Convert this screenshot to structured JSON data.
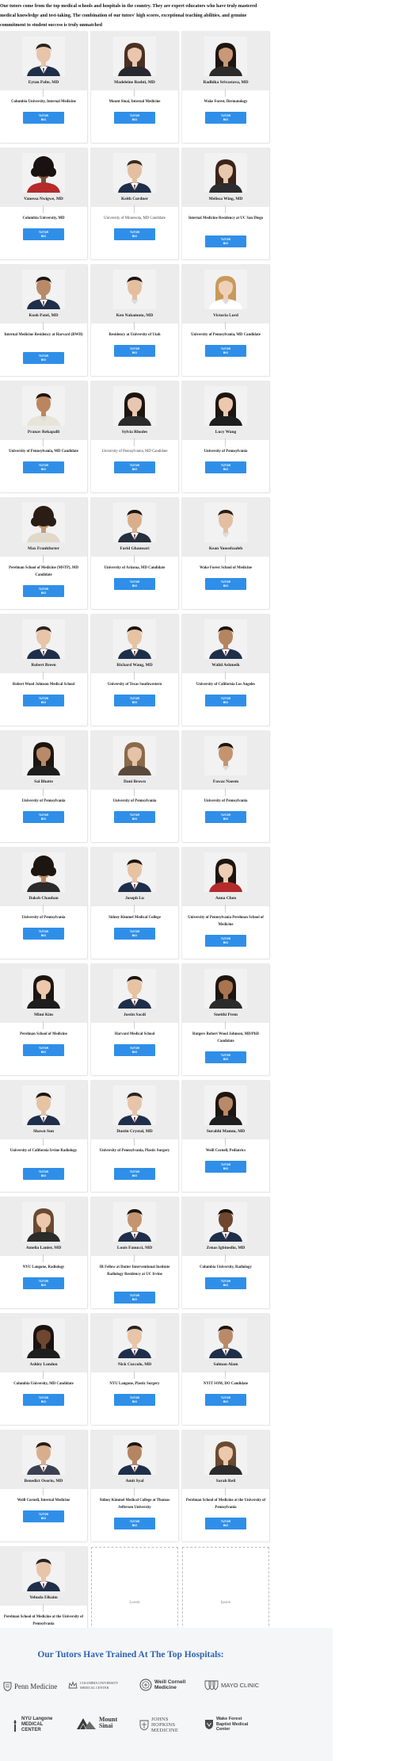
{
  "intro": "Our tutors come from the top medical schools and hospitals in the country. They are expert educators who have truly mastered medical knowledge and test-taking. The combination of our tutors' high scores, exceptional teaching abilities, and genuine commitment to student success is truly unmatched",
  "button": {
    "line1": "TUTOR",
    "line2": "BIO"
  },
  "colors": {
    "button": "#2f8fe8",
    "band": "#ececec",
    "heading": "#2a63b2"
  },
  "tutors": [
    {
      "name": "Eytan Palte, MD",
      "school": "Columbia University, Internal Medicine",
      "skin": "#e8c4a8",
      "hair": "#2a2420",
      "shirt": "#1f2f4a",
      "hairstyle": "short",
      "shirtstyle": "suit"
    },
    {
      "name": "Madeleine Bashti, MD",
      "school": "Mount Sinai, Internal Medicine",
      "skin": "#e9c6ac",
      "hair": "#4a3022",
      "shirt": "#27292e",
      "hairstyle": "long",
      "shirtstyle": "dark"
    },
    {
      "name": "Radhika Srivastava, MD",
      "school": "Wake Forest, Dermatology",
      "skin": "#c89878",
      "hair": "#1d1510",
      "shirt": "#2b2b2b",
      "hairstyle": "long",
      "shirtstyle": "dark"
    },
    {
      "name": "Vanessa Nwigwe, MD",
      "school": "Columbia University, MD",
      "skin": "#7a4f36",
      "hair": "#1a1210",
      "shirt": "#b52a2a",
      "hairstyle": "curly",
      "shirtstyle": "red"
    },
    {
      "name": "Keith Cordner",
      "school": "University of Minnesota, MD Candidate",
      "light": true,
      "skin": "#e3bfa2",
      "hair": "#3a2a20",
      "shirt": "#1f2f4a",
      "hairstyle": "short",
      "shirtstyle": "suit"
    },
    {
      "name": "Melissa Wing, MD",
      "school": "Internal Medicine Residency at UC San Diego",
      "skin": "#e9c7ad",
      "hair": "#3a2418",
      "shirt": "#2d2d30",
      "hairstyle": "long",
      "shirtstyle": "dark"
    },
    {
      "name": "Kush Patel, MD",
      "school": "Internal Medicine Residency at Harvard (BWH)",
      "skin": "#b98a68",
      "hair": "#1d1510",
      "shirt": "#1f2f4a",
      "hairstyle": "short",
      "shirtstyle": "suit"
    },
    {
      "name": "Ken Nakamoto, MD",
      "school": "Residency at University of Utah",
      "skin": "#e3bf9f",
      "hair": "#1d1510",
      "shirt": "#f2f2f2",
      "hairstyle": "short",
      "shirtstyle": "white"
    },
    {
      "name": "Victoria Lord",
      "school": "University of Pennsylvania, MD Candidate",
      "skin": "#efd0b8",
      "hair": "#c89a5a",
      "shirt": "#ffffff",
      "hairstyle": "long",
      "shirtstyle": "white"
    },
    {
      "name": "Pranav Rekapalli",
      "school": "University of Pennsylvania, MD Candidate",
      "skin": "#b9865f",
      "hair": "#1d1510",
      "shirt": "#e9e4d8",
      "hairstyle": "short",
      "shirtstyle": "white"
    },
    {
      "name": "Sylvia Rhodes",
      "school": "University of Pennsylvania, MD Candidate",
      "light": true,
      "skin": "#e8c7b0",
      "hair": "#1d1510",
      "shirt": "#2b2b2b",
      "hairstyle": "long",
      "shirtstyle": "dark"
    },
    {
      "name": "Lucy Wang",
      "school": "University of Pennsylvania",
      "skin": "#ecc9ad",
      "hair": "#1d1510",
      "shirt": "#1e1e1e",
      "hairstyle": "long",
      "shirtstyle": "dark"
    },
    {
      "name": "Max Frankfurter",
      "school": "Perelman School of Medicine (MSTP), MD Candidate",
      "skin": "#c89a74",
      "hair": "#2a1d14",
      "shirt": "#e0d9c8",
      "hairstyle": "curly",
      "shirtstyle": "white"
    },
    {
      "name": "Farid Ghamsari",
      "school": "University of Arizona, MD Candidate",
      "skin": "#d9ae8c",
      "hair": "#1d1510",
      "shirt": "#26303e",
      "hairstyle": "short",
      "shirtstyle": "suit"
    },
    {
      "name": "Kean Yousefzadeh",
      "school": "Wake Forest School of Medicine",
      "skin": "#e3bfa2",
      "hair": "#2a1d14",
      "shirt": "#f2f2f2",
      "hairstyle": "short",
      "shirtstyle": "white"
    },
    {
      "name": "Robert Breen",
      "school": "Robert Wood Johnson Medical School",
      "skin": "#e8c4a8",
      "hair": "#2a2420",
      "shirt": "#1f2f4a",
      "hairstyle": "short",
      "shirtstyle": "suit"
    },
    {
      "name": "Richard Wang, MD",
      "school": "University of Texas Southwestern",
      "skin": "#e6c3a3",
      "hair": "#1d1510",
      "shirt": "#1f2f4a",
      "hairstyle": "short",
      "shirtstyle": "suit"
    },
    {
      "name": "Walid Ashmeik",
      "school": "University of California Los Angeles",
      "skin": "#b58562",
      "hair": "#1d1510",
      "shirt": "#1f2f4a",
      "hairstyle": "short",
      "shirtstyle": "suit"
    },
    {
      "name": "Sai Bhatte",
      "school": "University of Pennsylvania",
      "skin": "#b98a68",
      "hair": "#1d1510",
      "shirt": "#1e1e1e",
      "hairstyle": "long",
      "shirtstyle": "dark"
    },
    {
      "name": "Dani Brown",
      "school": "University of Pennsylvania",
      "skin": "#e6c2a6",
      "hair": "#8a6a4a",
      "shirt": "#5a4a3c",
      "hairstyle": "long",
      "shirtstyle": "dark"
    },
    {
      "name": "Fawaz Naeem",
      "school": "University of Pennsylvania",
      "skin": "#c49470",
      "hair": "#1d1510",
      "shirt": "#f2f2f2",
      "hairstyle": "short",
      "shirtstyle": "white"
    },
    {
      "name": "Daksh Chauhan",
      "school": "University of Pennsylvania",
      "skin": "#b9865f",
      "hair": "#1d1510",
      "shirt": "#2b2b2b",
      "hairstyle": "curly",
      "shirtstyle": "dark"
    },
    {
      "name": "Joseph Lu",
      "school": "Sidney Kimmel Medical College",
      "skin": "#e6c3a3",
      "hair": "#1d1510",
      "shirt": "#1f2f4a",
      "hairstyle": "short",
      "shirtstyle": "suit"
    },
    {
      "name": "Anna Chen",
      "school": "University of Pennsylvania Perelman School of Medicine",
      "skin": "#edcdb3",
      "hair": "#1d1510",
      "shirt": "#b52a2a",
      "hairstyle": "long",
      "shirtstyle": "red"
    },
    {
      "name": "Mimi Kim",
      "school": "Perelman School of Medicine",
      "skin": "#ecc9ad",
      "hair": "#1d1510",
      "shirt": "#1e1e1e",
      "hairstyle": "long",
      "shirtstyle": "dark"
    },
    {
      "name": "Justin Sacdi",
      "school": "Harvard Medical School",
      "skin": "#e6c3a3",
      "hair": "#1d1510",
      "shirt": "#1f2f4a",
      "hairstyle": "short",
      "shirtstyle": "suit"
    },
    {
      "name": "Sneithi Prem",
      "school": "Rutgers Robert Wood Johnson, MD/PhD Candidate",
      "skin": "#a9754f",
      "hair": "#1d1510",
      "shirt": "#2b2b2b",
      "hairstyle": "long",
      "shirtstyle": "dark"
    },
    {
      "name": "Shawn Sun",
      "school": "University of California Irvine Radiology",
      "skin": "#e6c3a3",
      "hair": "#1d1510",
      "shirt": "#1f2f4a",
      "hairstyle": "short",
      "shirtstyle": "suit"
    },
    {
      "name": "Dustin Crystal, MD",
      "school": "University of Pennsylvania, Plastic Surgery",
      "skin": "#e8c4a8",
      "hair": "#2a2420",
      "shirt": "#1f2f4a",
      "hairstyle": "short",
      "shirtstyle": "suit"
    },
    {
      "name": "Surabhi Mamm, MD",
      "school": "Weill Cornell, Pediatrics",
      "skin": "#b98a68",
      "hair": "#1d1510",
      "shirt": "#1e1e1e",
      "hairstyle": "long",
      "shirtstyle": "dark"
    },
    {
      "name": "Amelia Lanier, MD",
      "school": "NYU Langone, Radiology",
      "skin": "#ecc9ad",
      "hair": "#6a4a30",
      "shirt": "#2b2b2b",
      "hairstyle": "long",
      "shirtstyle": "dark"
    },
    {
      "name": "Louis Fanucci, MD",
      "school": "IR Fellow at Dotter Interventional Institute Radiology Residency at UC Irvine",
      "skin": "#c49470",
      "hair": "#1d1510",
      "shirt": "#1f2f4a",
      "hairstyle": "short",
      "shirtstyle": "suit"
    },
    {
      "name": "Zenas Igbinedio, MD",
      "school": "Columbia University, Radiology",
      "skin": "#6f4630",
      "hair": "#1a1210",
      "shirt": "#1f2f4a",
      "hairstyle": "short",
      "shirtstyle": "suit"
    },
    {
      "name": "Ashley London",
      "school": "Columbia University, MD Candidate",
      "skin": "#6f4630",
      "hair": "#1a1210",
      "shirt": "#1e1e1e",
      "hairstyle": "long",
      "shirtstyle": "dark"
    },
    {
      "name": "Nick Cuccolo, MD",
      "school": "NYU Langone, Plastic Surgery",
      "skin": "#e8c4a8",
      "hair": "#2a2420",
      "shirt": "#1f2f4a",
      "hairstyle": "short",
      "shirtstyle": "suit"
    },
    {
      "name": "Salman Alam",
      "school": "NYIT SOM, DO Candidate",
      "skin": "#b98a68",
      "hair": "#1d1510",
      "shirt": "#1f2f4a",
      "hairstyle": "short",
      "shirtstyle": "suit"
    },
    {
      "name": "Benedict Osorio, MD",
      "school": "Weill Cornell, Internal Medicine",
      "skin": "#d9ae8c",
      "hair": "#2a1d14",
      "shirt": "#3a4050",
      "hairstyle": "short",
      "shirtstyle": "suit"
    },
    {
      "name": "Amit Syal",
      "school": "Sidney Kimmel Medical College at Thomas Jefferson University",
      "skin": "#b58562",
      "hair": "#1d1510",
      "shirt": "#1f2f4a",
      "hairstyle": "short",
      "shirtstyle": "suit"
    },
    {
      "name": "Sarah Reil",
      "school": "Perelman School of Medicine at the University of Pennsylvania",
      "skin": "#ecc9ad",
      "hair": "#6a4a30",
      "shirt": "#2b2b2b",
      "hairstyle": "long",
      "shirtstyle": "dark"
    },
    {
      "name": "Yehuda Elkaim",
      "school": "Perelman School of Medicine at the University of Pennsylvania",
      "skin": "#e8c4a8",
      "hair": "#2a2420",
      "shirt": "#1f2f4a",
      "hairstyle": "short",
      "shirtstyle": "suit"
    }
  ],
  "placeholders": [
    "Lorem",
    "Ipsum"
  ],
  "hospitals": {
    "title": "Our Tutors Have Trained At The Top Hospitals:",
    "logos": [
      {
        "text": "Penn Medicine",
        "icon": "penn-shield-icon"
      },
      {
        "text": "COLUMBIA UNIVERSITY MEDICAL CENTER",
        "icon": "columbia-crown-icon"
      },
      {
        "text": "Weill Cornell Medicine",
        "icon": "weill-cornell-seal-icon"
      },
      {
        "text": "MAYO CLINIC",
        "icon": "mayo-shields-icon"
      },
      {
        "text": "NYU Langone MEDICAL CENTER",
        "icon": "nyu-torch-icon"
      },
      {
        "text": "Mount Sinai",
        "icon": "mount-sinai-peaks-icon"
      },
      {
        "text": "JOHNS HOPKINS MEDICINE",
        "icon": "hopkins-shield-icon"
      },
      {
        "text": "Wake Forest Baptist Medical Center",
        "icon": "wake-forest-shield-icon"
      }
    ]
  }
}
